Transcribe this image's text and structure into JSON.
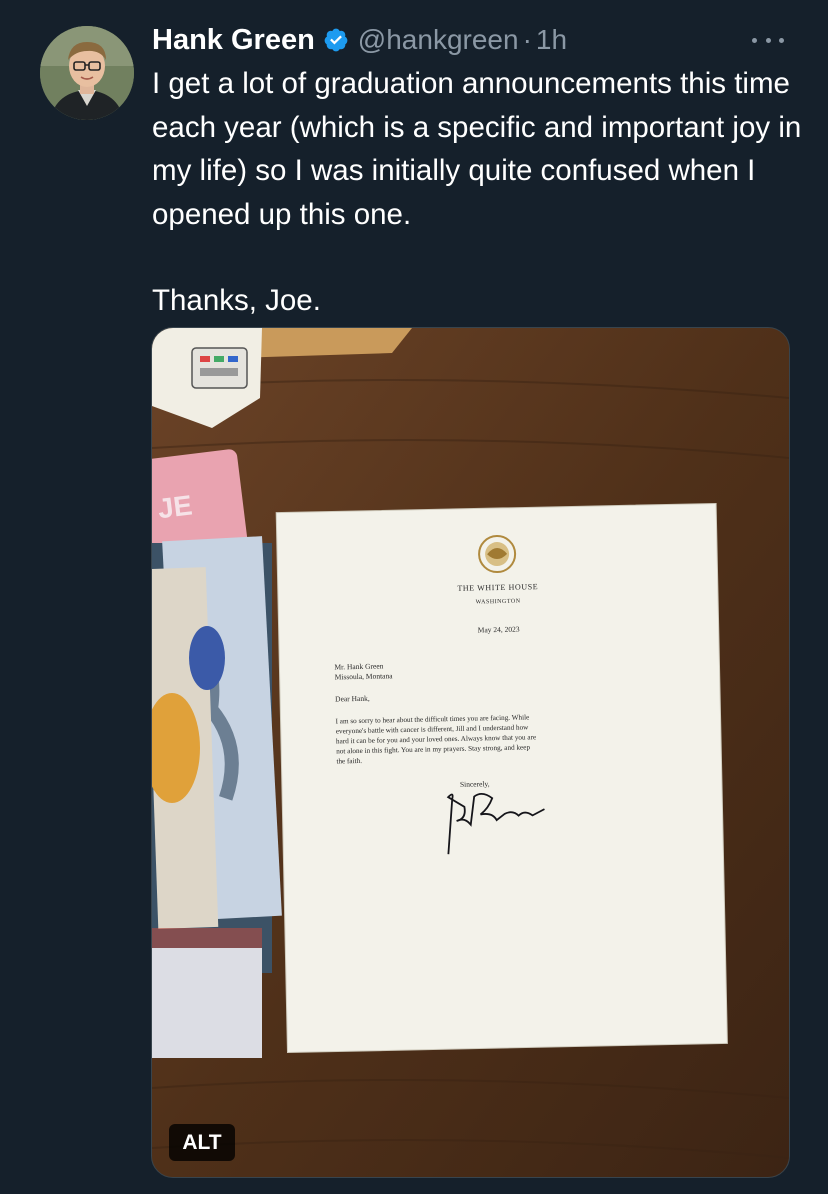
{
  "tweet": {
    "author_name": "Hank Green",
    "handle": "@hankgreen",
    "separator": "·",
    "time": "1h",
    "text_paragraph_1": "I get a lot of graduation announcements this time each year (which is a specific and important joy in my life) so I was initially quite confused when I opened up this one.",
    "text_paragraph_2": "Thanks, Joe.",
    "verified_icon": "verified-badge-icon",
    "more_icon": "more-options-icon",
    "accent_color": "#1d9bf0",
    "background_color": "#15202b",
    "secondary_text_color": "#8b98a5"
  },
  "media": {
    "alt_badge": "ALT",
    "letter": {
      "letterhead_title": "THE WHITE HOUSE",
      "letterhead_subtitle": "WASHINGTON",
      "date": "May 24, 2023",
      "recipient_line_1": "Mr. Hank Green",
      "recipient_line_2": "Missoula, Montana",
      "salutation": "Dear Hank,",
      "body_line_1": "I am so sorry to hear about the difficult times you are facing.  While",
      "body_line_2": "everyone's battle with cancer is different, Jill and I understand how",
      "body_line_3": "hard it can be for you and your loved ones.  Always know that you are",
      "body_line_4": "not alone in this fight.  You are in my prayers.  Stay strong, and keep",
      "body_line_5": "the faith.",
      "closing": "Sincerely,"
    }
  }
}
